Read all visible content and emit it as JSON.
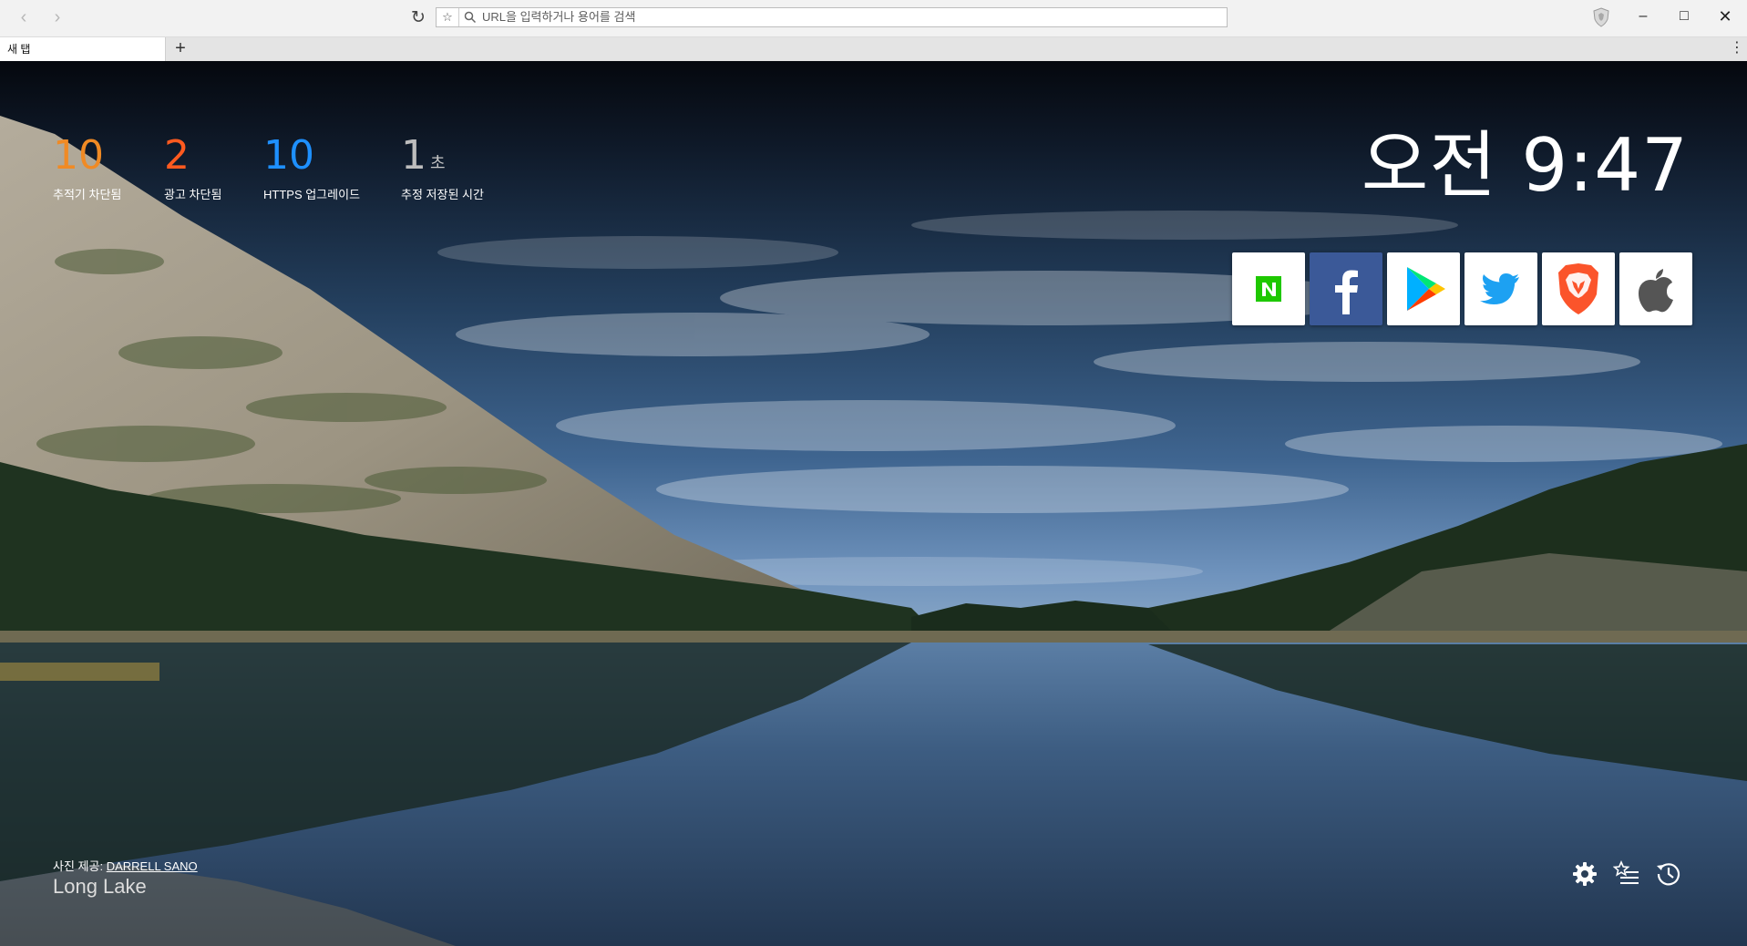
{
  "browser": {
    "url_placeholder": "URL을 입력하거나 용어를 검색",
    "tab_title": "새 탭",
    "new_tab_symbol": "+",
    "back_icon": "back-icon",
    "forward_icon": "forward-icon",
    "reload_icon": "reload-icon",
    "bookmark_icon": "star-icon",
    "search_icon": "search-icon",
    "brave_shield_icon": "brave-shield-icon",
    "window_controls": [
      "minimize-icon",
      "maximize-icon",
      "close-icon"
    ]
  },
  "stats": [
    {
      "value": "10",
      "unit": "",
      "label": "추적기 차단됨",
      "color": "#f08a24"
    },
    {
      "value": "2",
      "unit": "",
      "label": "광고 차단됨",
      "color": "#ff5a1f"
    },
    {
      "value": "10",
      "unit": "",
      "label": "HTTPS 업그레이드",
      "color": "#1e90ff"
    },
    {
      "value": "1",
      "unit": "초",
      "label": "추정 저장된 시간",
      "color": "#bdbdbd"
    }
  ],
  "clock": "오전 9:47",
  "top_sites": [
    {
      "name": "naver",
      "icon": "naver-icon",
      "color": "#1ec800"
    },
    {
      "name": "facebook",
      "icon": "facebook-icon",
      "color": "#3b5998"
    },
    {
      "name": "google-play",
      "icon": "google-play-icon",
      "color": "#00c853"
    },
    {
      "name": "twitter",
      "icon": "twitter-icon",
      "color": "#1da1f2"
    },
    {
      "name": "brave",
      "icon": "brave-lion-icon",
      "color": "#fb542b"
    },
    {
      "name": "apple",
      "icon": "apple-icon",
      "color": "#555555"
    }
  ],
  "photo": {
    "credit_prefix": "사진 제공:",
    "photographer": "DARRELL SANO",
    "location": "Long Lake"
  },
  "bottom_controls": [
    "settings-gear-icon",
    "bookmarks-icon",
    "history-icon"
  ]
}
